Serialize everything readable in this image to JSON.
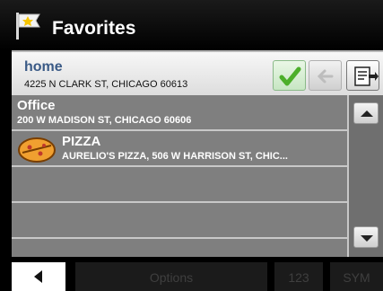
{
  "header": {
    "title": "Favorites",
    "icon": "favorites-flag-icon"
  },
  "selected": {
    "name": "home",
    "address": "4225 N CLARK ST, CHICAGO 60613",
    "actions": {
      "ok_icon": "checkmark-icon",
      "back_icon": "left-arrow-icon",
      "edit_icon": "edit-list-icon"
    }
  },
  "list": [
    {
      "title": "Office",
      "subtitle": "200 W MADISON ST, CHICAGO 60606"
    },
    {
      "title": "PIZZA",
      "subtitle": "AURELIO'S PIZZA, 506 W HARRISON ST, CHIC...",
      "icon": "pizza-icon"
    },
    {
      "title": "",
      "subtitle": ""
    },
    {
      "title": "",
      "subtitle": ""
    }
  ],
  "scroll": {
    "up_icon": "scroll-up-icon",
    "down_icon": "scroll-down-icon"
  },
  "bottombar": {
    "back_icon": "back-arrow-icon",
    "options": "Options",
    "num": "123",
    "sym": "SYM"
  },
  "colors": {
    "accent_name": "#3a5a86",
    "list_bg": "#7f7f7f",
    "ok_check": "#4caf2a"
  }
}
